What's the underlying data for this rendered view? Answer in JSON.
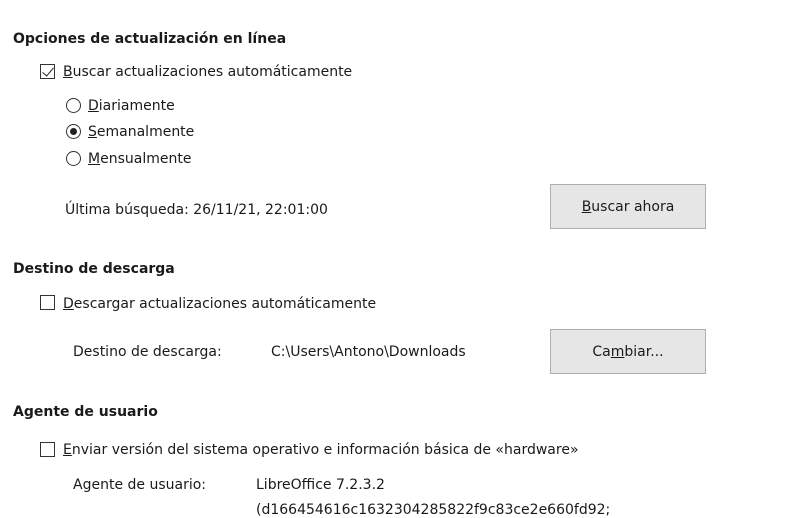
{
  "online_update": {
    "heading": "Opciones de actualización en línea",
    "auto_check": {
      "checked": true,
      "mnemonic": "B",
      "rest": "uscar actualizaciones automáticamente"
    },
    "frequency": {
      "selected": "weekly",
      "options": [
        {
          "id": "daily",
          "mnemonic": "D",
          "rest": "iariamente"
        },
        {
          "id": "weekly",
          "mnemonic": "S",
          "rest": "emanalmente"
        },
        {
          "id": "monthly",
          "mnemonic": "M",
          "rest": "ensualmente"
        }
      ]
    },
    "last_check_label": "Última búsqueda: 26/11/21, 22:01:00",
    "check_now_button": {
      "mnemonic": "B",
      "rest": "uscar ahora"
    }
  },
  "download": {
    "heading": "Destino de descarga",
    "auto_download": {
      "checked": false,
      "mnemonic": "D",
      "rest": "escargar actualizaciones automáticamente"
    },
    "destination_label": "Destino de descarga:",
    "destination_path": "C:\\Users\\Antono\\Downloads",
    "change_button": {
      "pre": "Ca",
      "mnemonic": "m",
      "rest": "biar..."
    }
  },
  "user_agent": {
    "heading": "Agente de usuario",
    "send_info": {
      "checked": false,
      "mnemonic": "E",
      "rest": "nviar versión del sistema operativo e información básica de «hardware»"
    },
    "agent_label": "Agente de usuario:",
    "agent_value_line1": "LibreOffice 7.2.3.2",
    "agent_value_line2": "(d166454616c1632304285822f9c83ce2e660fd92;"
  }
}
